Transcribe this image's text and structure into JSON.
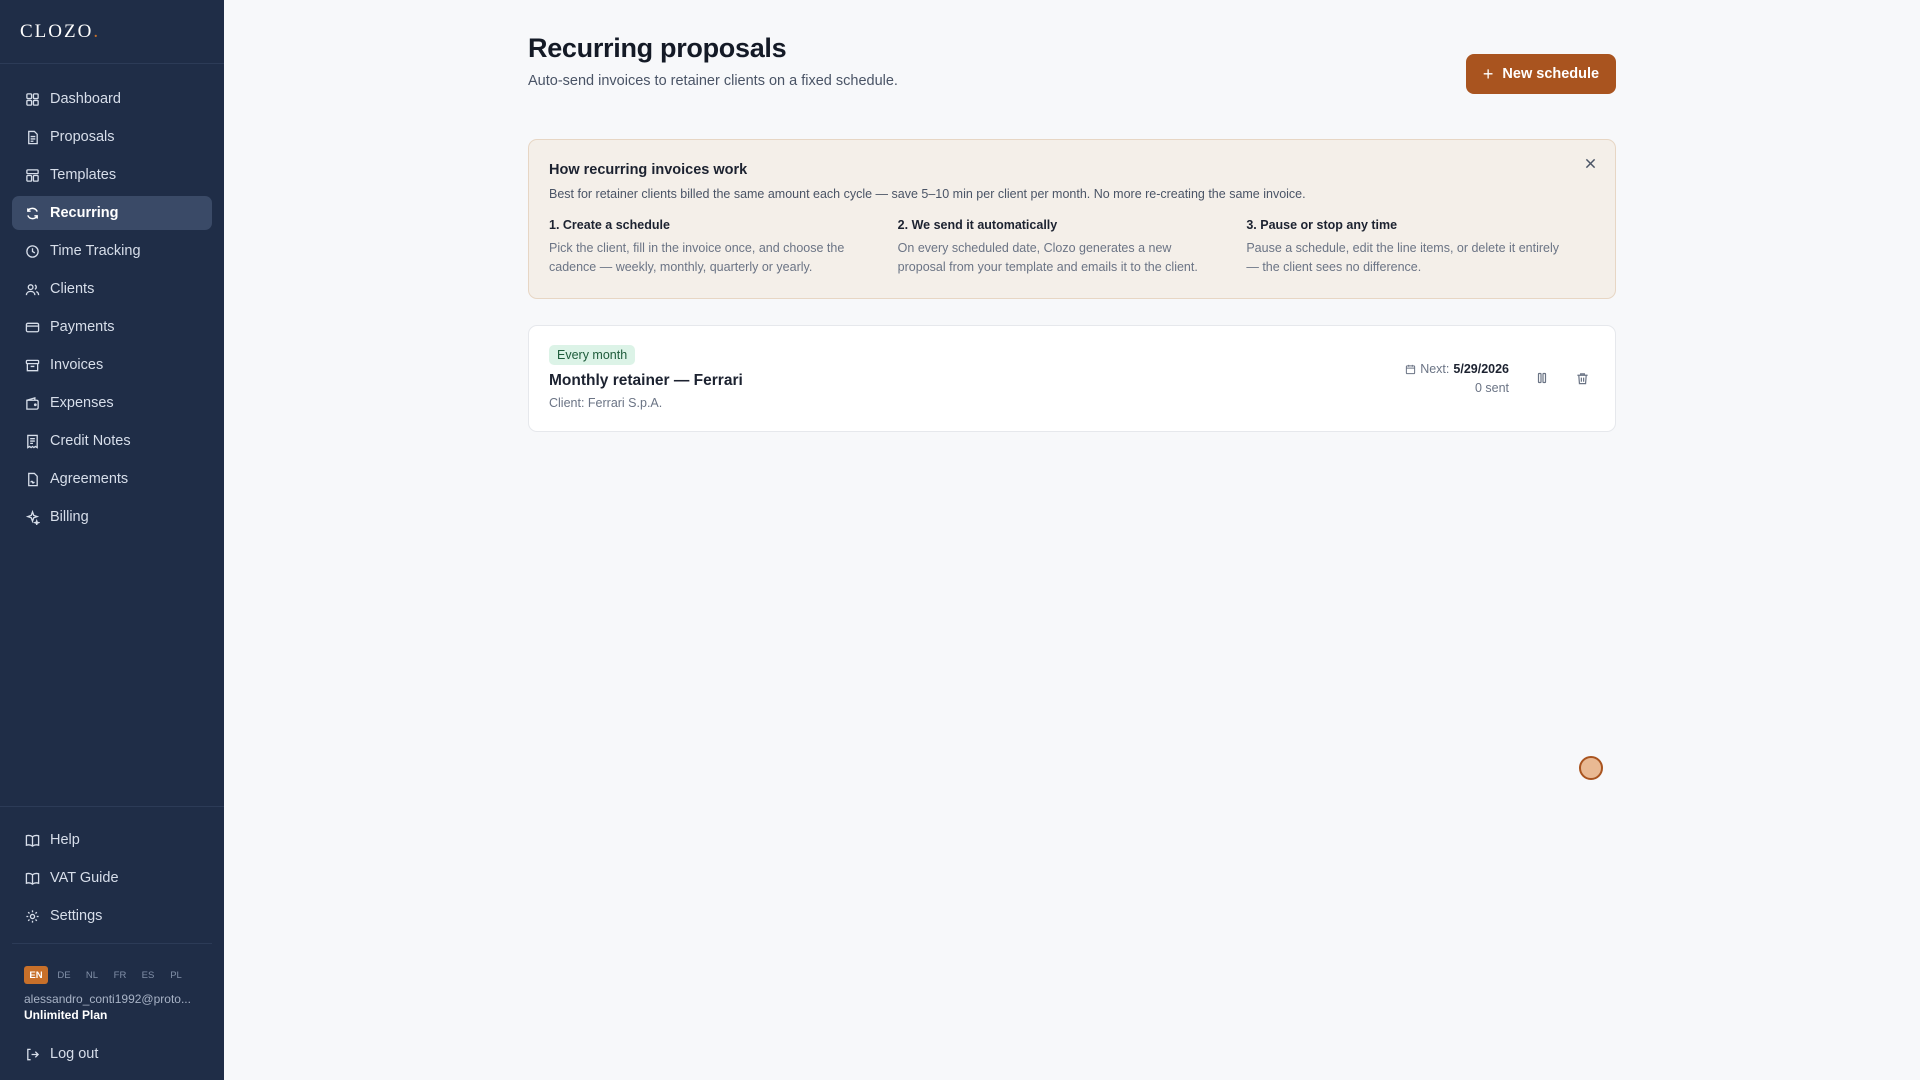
{
  "app": {
    "logo": "CLOZO",
    "logo_dot": "."
  },
  "sidebar": {
    "items": [
      {
        "label": "Dashboard",
        "icon": "dashboard-icon"
      },
      {
        "label": "Proposals",
        "icon": "document-icon"
      },
      {
        "label": "Templates",
        "icon": "templates-icon"
      },
      {
        "label": "Recurring",
        "icon": "refresh-icon",
        "active": true
      },
      {
        "label": "Time Tracking",
        "icon": "clock-icon"
      },
      {
        "label": "Clients",
        "icon": "users-icon"
      },
      {
        "label": "Payments",
        "icon": "card-icon"
      },
      {
        "label": "Invoices",
        "icon": "archive-icon"
      },
      {
        "label": "Expenses",
        "icon": "wallet-icon"
      },
      {
        "label": "Credit Notes",
        "icon": "receipt-icon"
      },
      {
        "label": "Agreements",
        "icon": "file-signature-icon"
      },
      {
        "label": "Billing",
        "icon": "sparkle-icon"
      }
    ],
    "bottom_items": [
      {
        "label": "Help",
        "icon": "book-icon"
      },
      {
        "label": "VAT Guide",
        "icon": "book-icon"
      },
      {
        "label": "Settings",
        "icon": "gear-icon"
      }
    ],
    "languages": [
      "EN",
      "DE",
      "NL",
      "FR",
      "ES",
      "PL"
    ],
    "active_language": "EN",
    "user_email": "alessandro_conti1992@proto...",
    "plan": "Unlimited Plan",
    "logout_label": "Log out"
  },
  "header": {
    "title": "Recurring proposals",
    "subtitle": "Auto-send invoices to retainer clients on a fixed schedule.",
    "new_button_label": "New schedule"
  },
  "info": {
    "title": "How recurring invoices work",
    "description": "Best for retainer clients billed the same amount each cycle — save 5–10 min per client per month. No more re-creating the same invoice.",
    "steps": [
      {
        "title": "1. Create a schedule",
        "text": "Pick the client, fill in the invoice once, and choose the cadence — weekly, monthly, quarterly or yearly."
      },
      {
        "title": "2. We send it automatically",
        "text": "On every scheduled date, Clozo generates a new proposal from your template and emails it to the client."
      },
      {
        "title": "3. Pause or stop any time",
        "text": "Pause a schedule, edit the line items, or delete it entirely — the client sees no difference."
      }
    ]
  },
  "schedules": [
    {
      "badge": "Every month",
      "title": "Monthly retainer — Ferrari",
      "client": "Client: Ferrari S.p.A.",
      "next_label": "Next:",
      "next_date": "5/29/2026",
      "sent": "0 sent"
    }
  ],
  "colors": {
    "sidebar_bg": "#1f2d47",
    "accent": "#a9541f",
    "badge_bg": "#dcf3e7",
    "info_bg": "#f4efe9"
  }
}
